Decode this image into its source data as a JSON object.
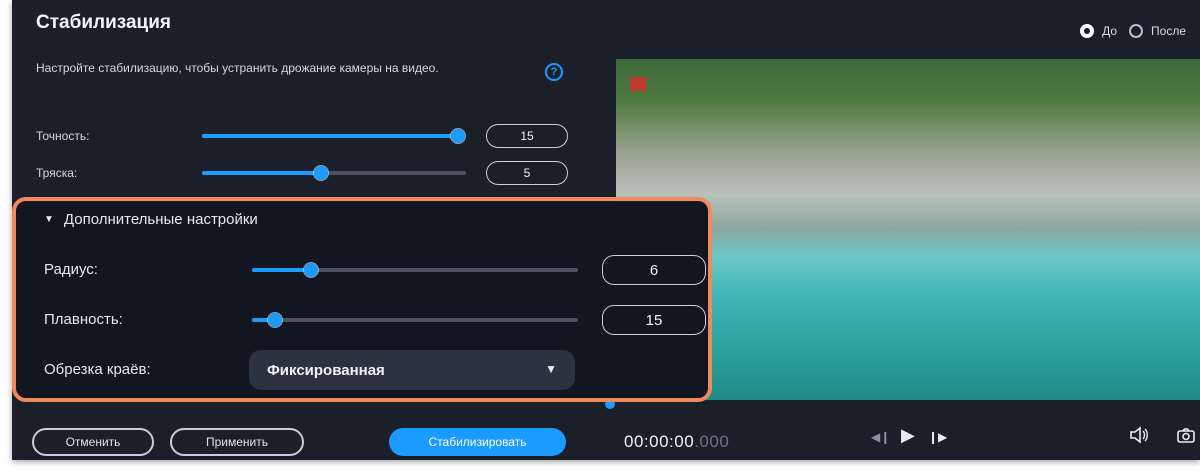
{
  "dialog": {
    "title": "Стабилизация",
    "view_mode": {
      "before_label": "До",
      "after_label": "После",
      "selected": "До"
    },
    "description": "Настройте стабилизацию, чтобы устранить дрожание камеры на видео.",
    "help_glyph": "?"
  },
  "settings": {
    "accuracy": {
      "label": "Точность:",
      "value": "15",
      "fill_fraction": 1.0
    },
    "shake": {
      "label": "Тряска:",
      "value": "5",
      "fill_fraction": 0.45
    }
  },
  "advanced": {
    "header": "Дополнительные настройки",
    "radius": {
      "label": "Радиус:",
      "value": "6",
      "fill_fraction": 0.18
    },
    "smoothness": {
      "label": "Плавность:",
      "value": "15",
      "fill_fraction": 0.07
    },
    "edge_crop": {
      "label": "Обрезка краёв:",
      "selected": "Фиксированная"
    }
  },
  "buttons": {
    "cancel": "Отменить",
    "apply": "Применить",
    "stabilize": "Стабилизировать"
  },
  "player": {
    "timecode_main": "00:00:00",
    "timecode_ms": ".000",
    "icons": [
      "prev-frame-icon",
      "play-icon",
      "next-frame-icon",
      "volume-icon",
      "snapshot-icon"
    ]
  },
  "colors": {
    "accent": "#1c9bff",
    "highlight": "#f08a5b",
    "background": "#1a1f2a"
  }
}
